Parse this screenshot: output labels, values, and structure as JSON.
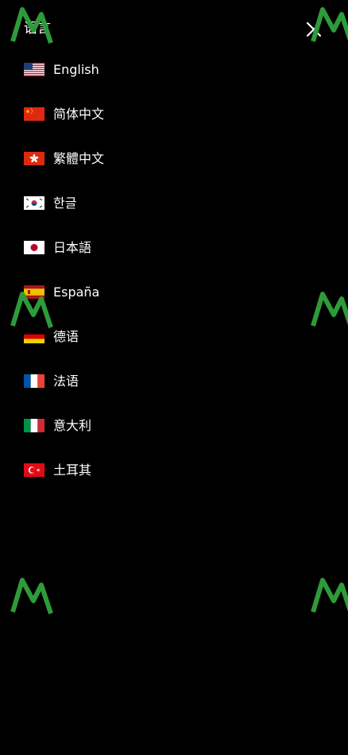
{
  "header": {
    "title": "语言",
    "close_icon": "close-icon"
  },
  "languages": [
    {
      "label": "English",
      "flag": "flag-us-icon"
    },
    {
      "label": "简体中文",
      "flag": "flag-cn-icon"
    },
    {
      "label": "繁體中文",
      "flag": "flag-hk-icon"
    },
    {
      "label": "한글",
      "flag": "flag-kr-icon"
    },
    {
      "label": "日本語",
      "flag": "flag-jp-icon"
    },
    {
      "label": "España",
      "flag": "flag-es-icon"
    },
    {
      "label": "德语",
      "flag": "flag-de-icon"
    },
    {
      "label": "法语",
      "flag": "flag-fr-icon"
    },
    {
      "label": "意大利",
      "flag": "flag-it-icon"
    },
    {
      "label": "土耳其",
      "flag": "flag-tr-icon"
    }
  ],
  "colors": {
    "background": "#000000",
    "text": "#ffffff",
    "watermark": "#2e9b3a"
  }
}
